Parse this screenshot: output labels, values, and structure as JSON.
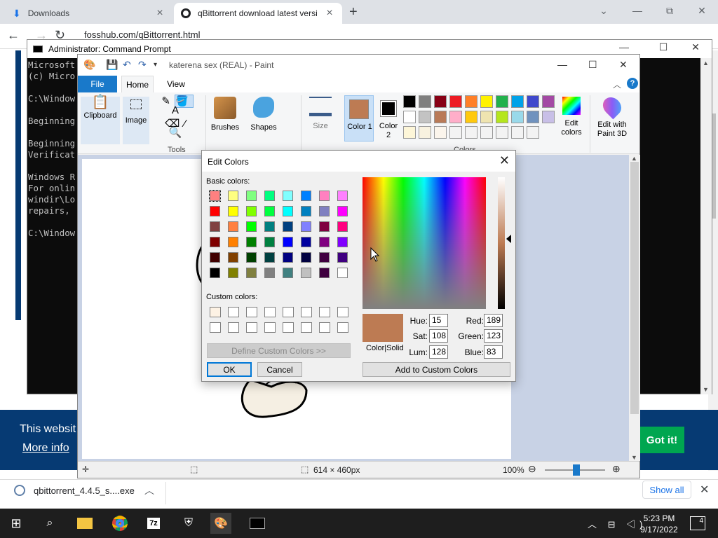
{
  "browser": {
    "tabs": [
      {
        "label": "Downloads"
      },
      {
        "label": "qBittorrent download latest versi"
      }
    ],
    "url": "fosshub.com/qBittorrent.html",
    "new_tab_icon": "+",
    "window_controls": {
      "minimize": "—",
      "maximize": "⧉",
      "close": "✕"
    }
  },
  "webpage": {
    "cookie_text": "This websit",
    "cookie_more": "More info",
    "got_it": "Got it!"
  },
  "downloads_bar": {
    "file": "qbittorrent_4.4.5_s....exe",
    "show_all": "Show all"
  },
  "cmd": {
    "title": "Administrator: Command Prompt",
    "lines": [
      "Microsoft",
      "(c) Micro",
      "",
      "C:\\Window",
      "",
      "Beginning",
      "",
      "Beginning",
      "Verificat",
      "",
      "Windows R",
      "For onlin",
      "windir\\Lo",
      "repairs,",
      "",
      "C:\\Window"
    ]
  },
  "paint": {
    "title": "katerena sex (REAL) - Paint",
    "tabs": {
      "file": "File",
      "home": "Home",
      "view": "View"
    },
    "ribbon": {
      "clipboard": "Clipboard",
      "image": "Image",
      "tools": "Tools",
      "brushes": "Brushes",
      "shapes": "Shapes",
      "size": "Size",
      "color1": "Color 1",
      "color2": "Color 2",
      "colors": "Colors",
      "edit_colors": "Edit colors",
      "edit_paint3d": "Edit with Paint 3D"
    },
    "palette_row1": [
      "#000000",
      "#7f7f7f",
      "#880015",
      "#ed1c24",
      "#ff7f27",
      "#fff200",
      "#22b14c",
      "#00a2e8",
      "#3f48cc",
      "#a349a4"
    ],
    "palette_row2": [
      "#ffffff",
      "#c3c3c3",
      "#b97a57",
      "#ffaec9",
      "#ffc90e",
      "#efe4b0",
      "#b5e61d",
      "#99d9ea",
      "#7092be",
      "#c8bfe7"
    ],
    "palette_row3": [
      "#fdf6d8",
      "#f8f2e0",
      "#fbf5ec",
      "#f3f3f3",
      "#f3f3f3",
      "#f3f3f3",
      "#f3f3f3",
      "#f3f3f3",
      "#f3f3f3"
    ],
    "color1_hex": "#bd7b53",
    "status": {
      "dimensions": "614 × 460px",
      "zoom": "100%"
    }
  },
  "edit_colors": {
    "title": "Edit Colors",
    "basic_label": "Basic colors:",
    "custom_label": "Custom colors:",
    "basic_colors": [
      "#ff8080",
      "#ffff80",
      "#80ff80",
      "#00ff80",
      "#80ffff",
      "#0080ff",
      "#ff80c0",
      "#ff80ff",
      "#ff0000",
      "#ffff00",
      "#80ff00",
      "#00ff40",
      "#00ffff",
      "#0080c0",
      "#8080c0",
      "#ff00ff",
      "#804040",
      "#ff8040",
      "#00ff00",
      "#008080",
      "#004080",
      "#8080ff",
      "#800040",
      "#ff0080",
      "#800000",
      "#ff8000",
      "#008000",
      "#008040",
      "#0000ff",
      "#0000a0",
      "#800080",
      "#8000ff",
      "#400000",
      "#804000",
      "#004000",
      "#004040",
      "#000080",
      "#000040",
      "#400040",
      "#400080",
      "#000000",
      "#808000",
      "#808040",
      "#808080",
      "#408080",
      "#c0c0c0",
      "#400040",
      "#ffffff"
    ],
    "custom_colors": [
      "#fdf2e4",
      "#ffffff",
      "#ffffff",
      "#ffffff",
      "#ffffff",
      "#ffffff",
      "#ffffff",
      "#ffffff",
      "#ffffff",
      "#ffffff",
      "#ffffff",
      "#ffffff",
      "#ffffff",
      "#ffffff",
      "#ffffff",
      "#ffffff"
    ],
    "define_btn": "Define Custom Colors >>",
    "ok": "OK",
    "cancel": "Cancel",
    "color_solid": "Color|Solid",
    "hue_label": "Hue:",
    "hue": "15",
    "sat_label": "Sat:",
    "sat": "108",
    "lum_label": "Lum:",
    "lum": "128",
    "red_label": "Red:",
    "red": "189",
    "green_label": "Green:",
    "green": "123",
    "blue_label": "Blue:",
    "blue": "83",
    "add_custom": "Add to Custom Colors"
  },
  "taskbar": {
    "time": "5:23 PM",
    "date": "9/17/2022",
    "notifications": "4"
  }
}
